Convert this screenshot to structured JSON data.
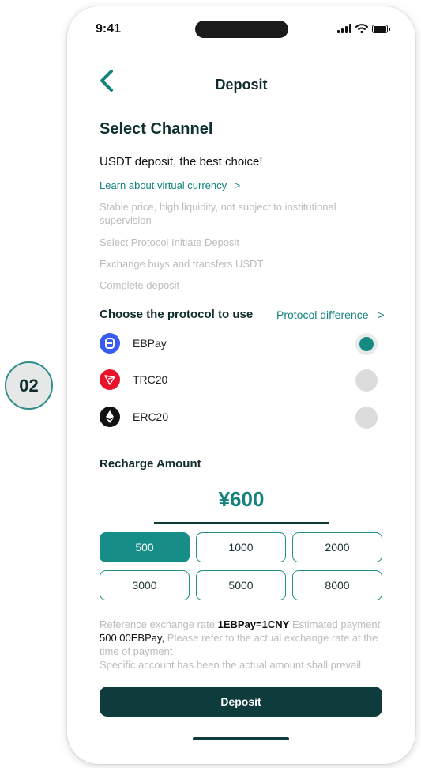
{
  "step": {
    "number": "02"
  },
  "status_bar": {
    "time": "9:41"
  },
  "header": {
    "title": "Deposit"
  },
  "channel": {
    "section_title": "Select Channel",
    "headline": "USDT deposit, the best choice!",
    "learn_link": "Learn about virtual currency",
    "notes": [
      "Stable price, high liquidity, not subject to institutional supervision",
      "Select Protocol Initiate Deposit",
      "Exchange buys and transfers USDT",
      "Complete deposit"
    ]
  },
  "protocol": {
    "title": "Choose the protocol to use",
    "difference_link": "Protocol difference",
    "options": [
      {
        "label": "EBPay",
        "icon": "ebpay-icon",
        "color": "#3a5bf0",
        "selected": true
      },
      {
        "label": "TRC20",
        "icon": "tron-icon",
        "color": "#e8132a",
        "selected": false
      },
      {
        "label": "ERC20",
        "icon": "ethereum-icon",
        "color": "#111111",
        "selected": false
      }
    ]
  },
  "recharge": {
    "title": "Recharge Amount",
    "amount": "¥600",
    "options": [
      "500",
      "1000",
      "2000",
      "3000",
      "5000",
      "8000"
    ],
    "selected": "500"
  },
  "rate_note": {
    "t1": "Reference exchange rate",
    "rate": "1EBPay=1CNY",
    "t2": "Estimated payment",
    "payment": "500.00EBPay,",
    "t3": "Please refer to the actual exchange rate at the time of payment",
    "t4": "Specific account has been the actual amount shall prevail"
  },
  "cta": {
    "deposit_label": "Deposit"
  },
  "colors": {
    "accent": "#14837c",
    "dark": "#0e3b3b"
  }
}
